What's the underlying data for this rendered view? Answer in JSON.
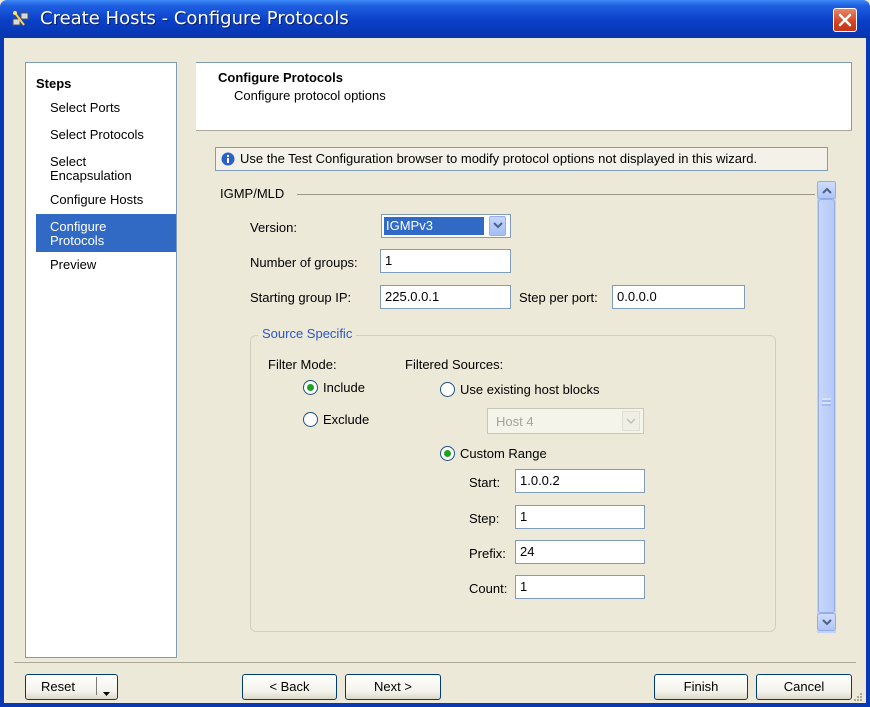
{
  "window": {
    "title": "Create Hosts - Configure Protocols",
    "icons": {
      "app": "wizard-hosts-icon",
      "close": "close-icon"
    }
  },
  "steps": {
    "heading": "Steps",
    "items": [
      {
        "label": "Select Ports",
        "active": false
      },
      {
        "label": "Select Protocols",
        "active": false
      },
      {
        "label": "Select Encapsulation",
        "active": false
      },
      {
        "label": "Configure Hosts",
        "active": false
      },
      {
        "label": "Configure Protocols",
        "active": true
      },
      {
        "label": "Preview",
        "active": false
      }
    ]
  },
  "header": {
    "title": "Configure Protocols",
    "subtitle": "Configure protocol options"
  },
  "info": {
    "icon": "info-icon",
    "text": "Use the Test Configuration browser to modify protocol options not displayed in this wizard."
  },
  "igmp": {
    "group_label": "IGMP/MLD",
    "version_label": "Version:",
    "version_value": "IGMPv3",
    "num_groups_label": "Number of groups:",
    "num_groups_value": "1",
    "start_ip_label": "Starting group IP:",
    "start_ip_value": "225.0.0.1",
    "step_per_port_label": "Step per port:",
    "step_per_port_value": "0.0.0.0"
  },
  "source": {
    "group_label": "Source Specific",
    "filter_mode_label": "Filter Mode:",
    "include_label": "Include",
    "exclude_label": "Exclude",
    "filter_mode_selected": "Include",
    "filtered_sources_label": "Filtered Sources:",
    "use_existing_label": "Use existing host blocks",
    "host_block_value": "Host 4",
    "custom_range_label": "Custom Range",
    "filtered_sources_selected": "Custom Range",
    "start_label": "Start:",
    "start_value": "1.0.0.2",
    "step_label": "Step:",
    "step_value": "1",
    "prefix_label": "Prefix:",
    "prefix_value": "24",
    "count_label": "Count:",
    "count_value": "1"
  },
  "buttons": {
    "reset": "Reset",
    "back": "< Back",
    "next": "Next >",
    "finish": "Finish",
    "cancel": "Cancel"
  },
  "colors": {
    "titlebar": "#0a3fc8",
    "selection": "#316ac5",
    "group_title": "#2a56c6",
    "radio_dot": "#21a121"
  }
}
